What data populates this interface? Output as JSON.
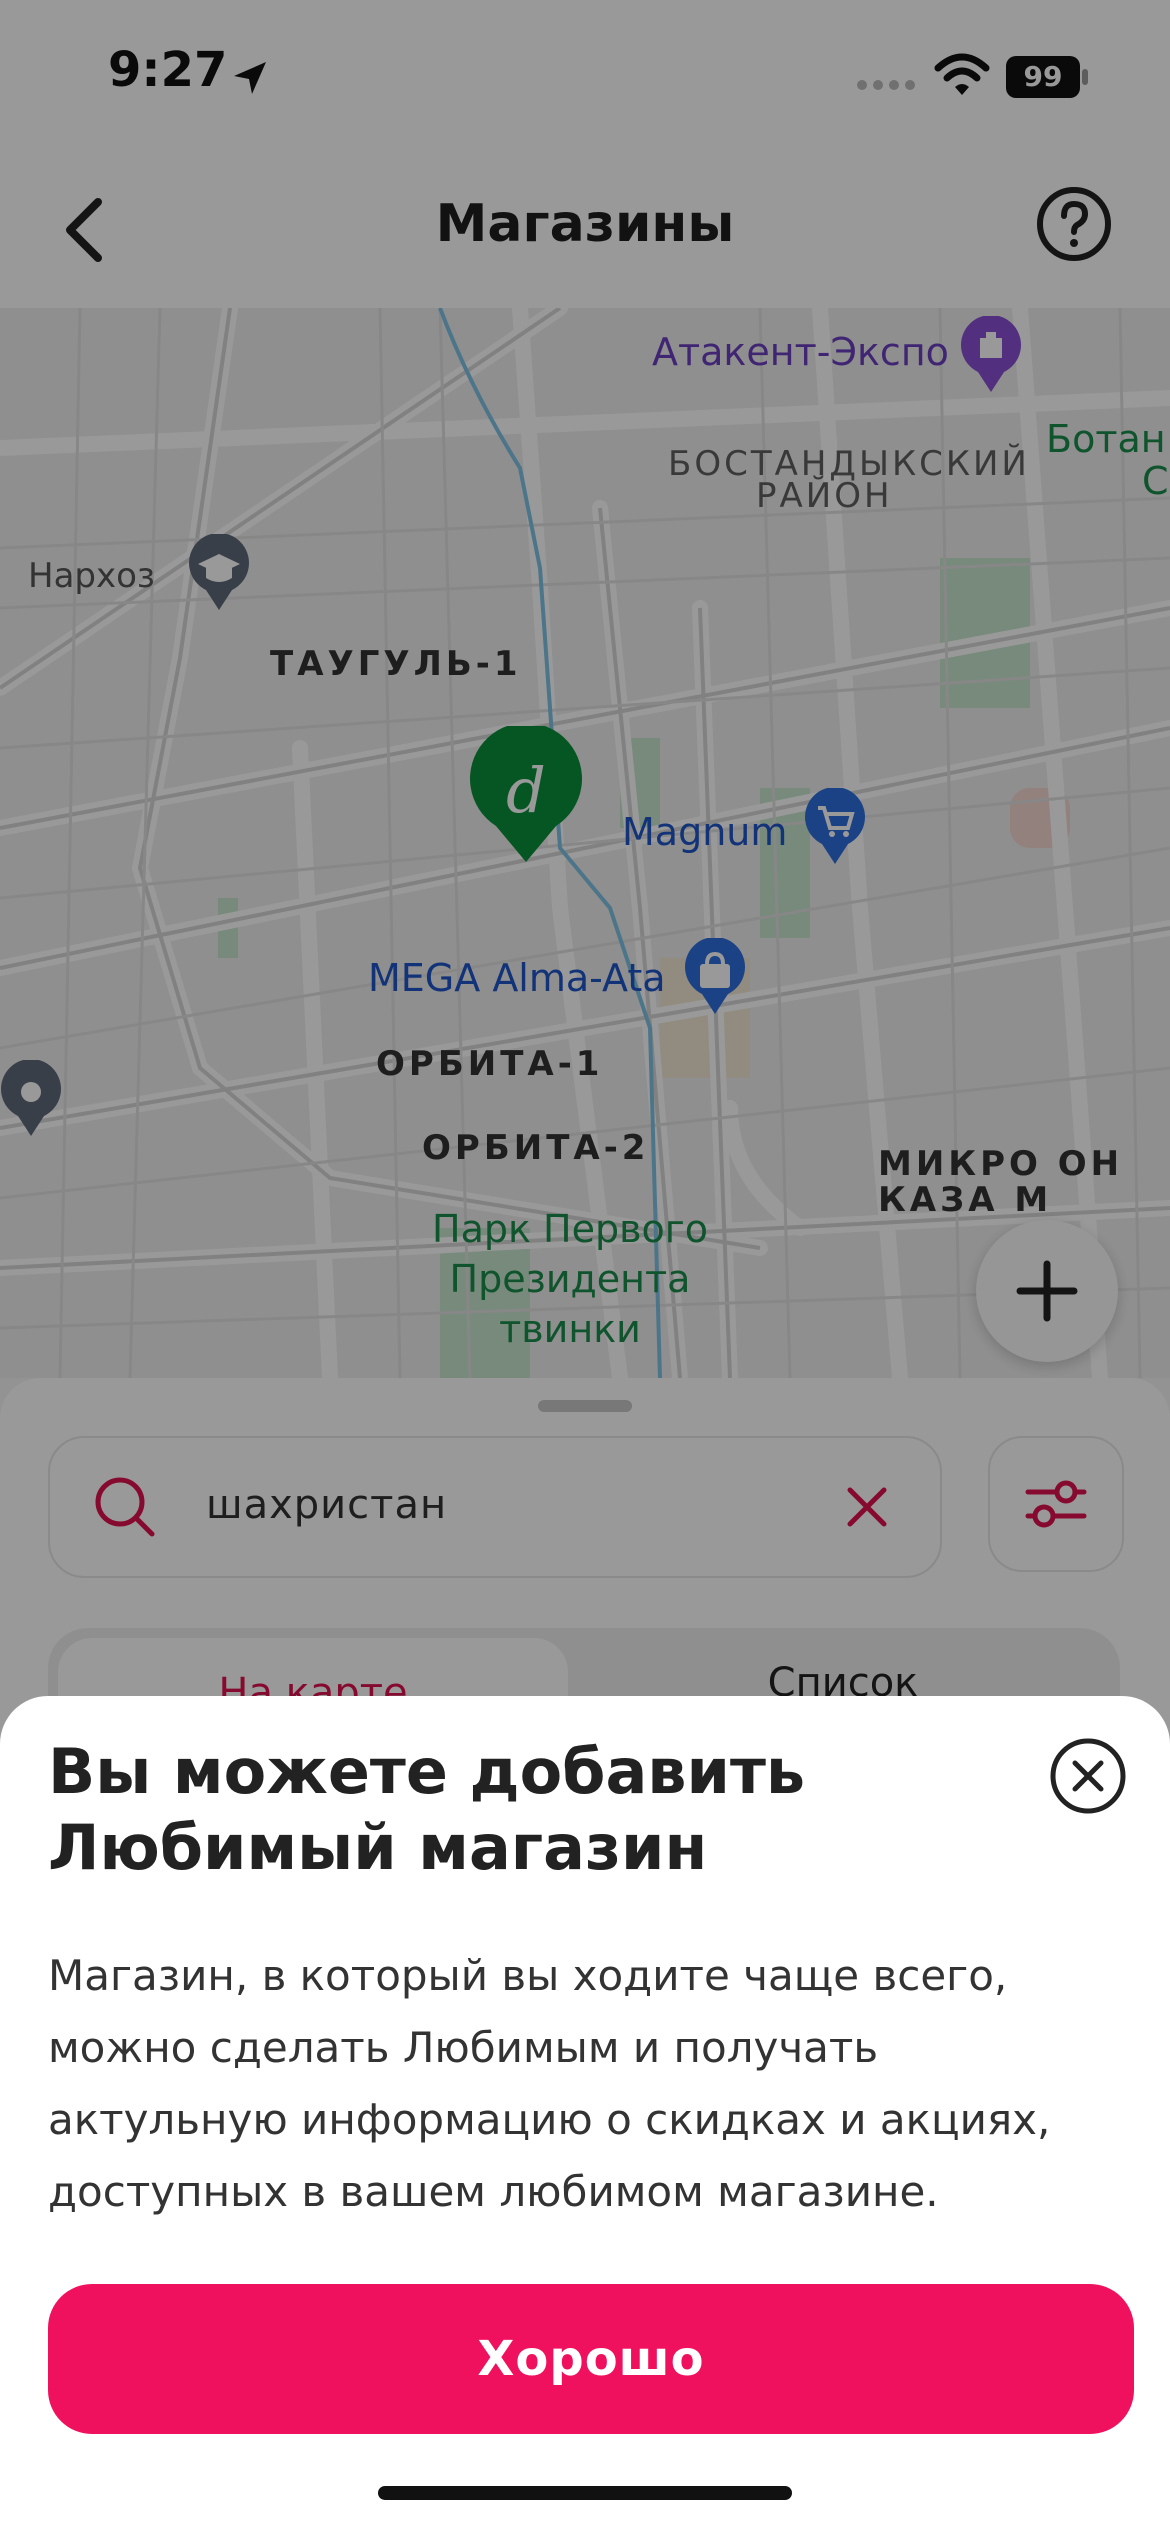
{
  "status_bar": {
    "time": "9:27",
    "battery": "99"
  },
  "header": {
    "title": "Магазины"
  },
  "map": {
    "labels": {
      "atakent": "Атакент-Экспо",
      "district_line1": "БОСТАНДЫКСКИЙ",
      "district_line2": "РАЙОН",
      "botan_line1": "Ботан",
      "botan_line2": "С",
      "narkhoz": "Нархоз",
      "taugul": "ТАУГУЛЬ-1",
      "magnum": "Magnum",
      "mega": "MEGA Alma-Ata",
      "orbita1": "ОРБИТА-1",
      "orbita2": "ОРБИТА-2",
      "micro_line1": "МИКРО   ОН",
      "micro_line2": "КАЗА       М",
      "park_line1": "Парк Первого",
      "park_line2": "Президента",
      "park_line3": "твинки"
    },
    "zoom_in": "+",
    "zoom_out": "−"
  },
  "search": {
    "value": "шахристан"
  },
  "tabs": {
    "map": "На карте",
    "list": "Список"
  },
  "sheet": {
    "title": "Вы можете добавить Любимый магазин",
    "body": "Магазин, в который вы ходите чаще всего, можно сделать Любимым и получать актульную информацию о скидках и акциях, доступных в вашем любимом магазине.",
    "button": "Хорошо"
  },
  "colors": {
    "accent": "#f0115e",
    "store_pin": "#0a8f3c",
    "tab_active_text": "#e0124f"
  }
}
